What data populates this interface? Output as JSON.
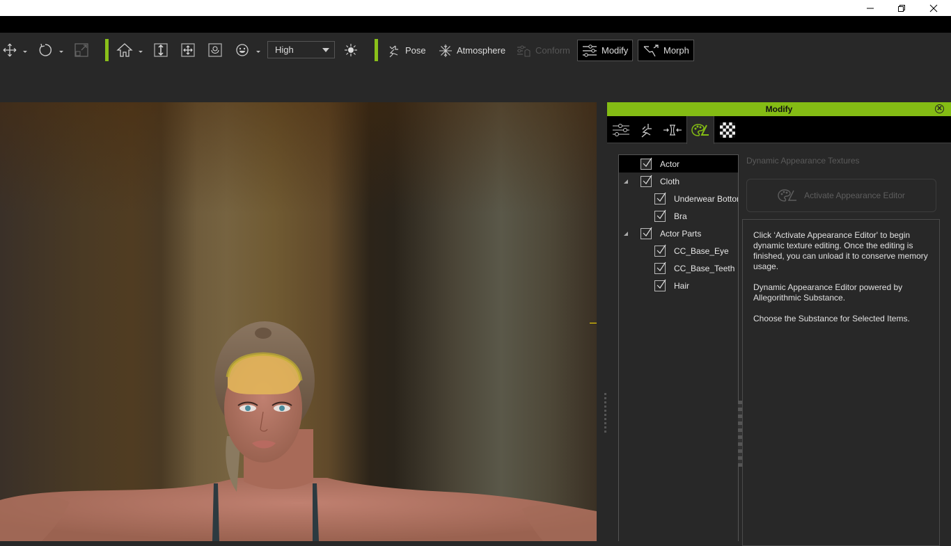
{
  "window": {
    "controls": {
      "minimize": "—",
      "maximize": "❐",
      "close": "✕"
    }
  },
  "toolbar": {
    "icons": [
      {
        "name": "move-icon",
        "glyph": "✥"
      },
      {
        "name": "rotate-icon",
        "glyph": "↻"
      },
      {
        "name": "scale-icon",
        "glyph": "⤢"
      },
      {
        "name": "home-icon",
        "glyph": "⌂"
      },
      {
        "name": "vertical-fit-icon",
        "glyph": "↕"
      },
      {
        "name": "pan-icon",
        "glyph": "✥"
      },
      {
        "name": "orbit-icon",
        "glyph": "⟲"
      },
      {
        "name": "face-icon",
        "glyph": "☺"
      },
      {
        "name": "light-icon",
        "glyph": "☀"
      }
    ],
    "quality_select": {
      "value": "High"
    },
    "buttons": {
      "pose": "Pose",
      "atmosphere": "Atmosphere",
      "conform": "Conform",
      "modify": "Modify",
      "morph": "Morph"
    }
  },
  "panel": {
    "title": "Modify",
    "close_glyph": "⊗",
    "tabs": [
      {
        "name": "tab-attributes",
        "glyph": "☰"
      },
      {
        "name": "tab-motion",
        "glyph": "🏃"
      },
      {
        "name": "tab-fit",
        "glyph": "⇥⇤"
      },
      {
        "name": "tab-appearance",
        "glyph": "🎨",
        "active": true
      },
      {
        "name": "tab-texture",
        "glyph": "▦"
      }
    ],
    "tree": [
      {
        "label": "Actor",
        "level": 0,
        "checked": true,
        "selected": true,
        "expandable": false
      },
      {
        "label": "Cloth",
        "level": 0,
        "checked": true,
        "expandable": true
      },
      {
        "label": "Underwear Bottom",
        "level": 1,
        "checked": true
      },
      {
        "label": "Bra",
        "level": 1,
        "checked": true
      },
      {
        "label": "Actor Parts",
        "level": 0,
        "checked": true,
        "expandable": true
      },
      {
        "label": "CC_Base_Eye",
        "level": 1,
        "checked": true
      },
      {
        "label": "CC_Base_Teeth",
        "level": 1,
        "checked": true
      },
      {
        "label": "Hair",
        "level": 1,
        "checked": true
      }
    ],
    "section_title": "Dynamic Appearance Textures",
    "activate_button": "Activate Appearance Editor",
    "info": [
      "Click ‘Activate Appearance Editor' to begin dynamic texture editing. Once the editing is finished, you can unload it to conserve memory usage.",
      "Dynamic Appearance Editor powered by Allegorithmic Substance.",
      "Choose the Substance for Selected Items."
    ]
  },
  "colors": {
    "accent": "#84bc14",
    "panel_bg": "#282828",
    "toolbar_bg": "#282828",
    "gizmo": "#ffe000"
  }
}
